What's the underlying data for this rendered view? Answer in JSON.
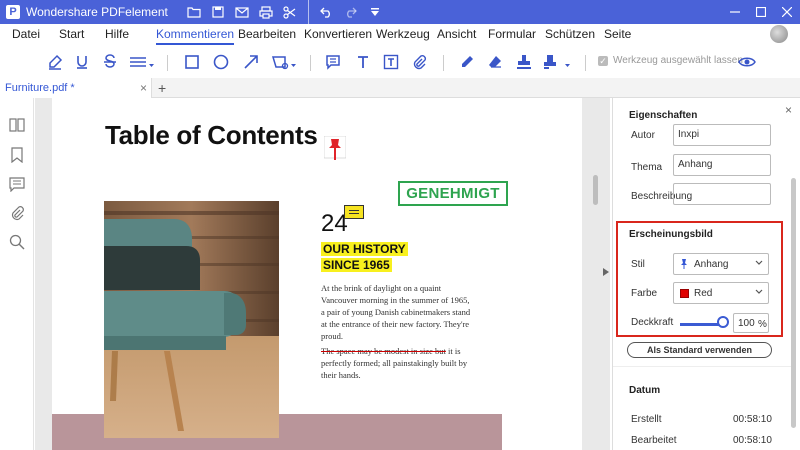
{
  "app": {
    "title": "Wondershare PDFelement",
    "accent": "#4a62d8"
  },
  "titlebar": {
    "quick_access_icons": [
      "folder-icon",
      "save-icon",
      "mail-icon",
      "print-icon",
      "scissors-icon",
      "undo-icon",
      "redo-icon",
      "quick-access-dropdown-icon"
    ],
    "window_buttons": [
      "minimize-icon",
      "maximize-icon",
      "close-icon"
    ]
  },
  "menu": {
    "items": [
      "Datei",
      "Start",
      "Hilfe",
      "Kommentieren",
      "Bearbeiten",
      "Konvertieren",
      "Werkzeug",
      "Ansicht",
      "Formular",
      "Schützen",
      "Seite"
    ],
    "active": "Kommentieren"
  },
  "toolbar": {
    "tools": [
      "highlight-icon",
      "underline-icon",
      "strikethrough-icon",
      "lines-icon",
      "rectangle-icon",
      "circle-icon",
      "arrow-icon",
      "shapes-icon",
      "comment-icon",
      "text-icon",
      "textbox-icon",
      "attachment-icon",
      "pencil-icon",
      "eraser-icon",
      "stamp-icon",
      "signature-icon"
    ],
    "keep_tool_label": "Werkzeug ausgewählt lassen",
    "eye_icon": "eye-icon"
  },
  "tabs": {
    "doc_tab": "Furniture.pdf *",
    "add": "+"
  },
  "leftbar": {
    "icons": [
      "thumbnails-icon",
      "bookmark-icon",
      "comments-icon",
      "attachments-icon",
      "search-icon"
    ]
  },
  "document": {
    "title": "Table of Contents",
    "stamp": "GENEHMIGT",
    "number": "24",
    "history_line1": "OUR HISTORY",
    "history_line2": "SINCE 1965",
    "paragraph1": "At the brink of daylight on a quaint Vancouver morning in the summer of 1965, a pair of young Danish cabinetmakers stand at the entrance of their new factory. They're proud.",
    "paragraph2_strike": "The space may be modest in size but",
    "paragraph2_rest": " it is perfectly formed; all painstakingly built by their hands."
  },
  "properties": {
    "heading": "Eigenschaften",
    "author_label": "Autor",
    "author_value": "Inxpi",
    "subject_label": "Thema",
    "subject_value": "Anhang",
    "description_label": "Beschreibung",
    "description_value": ""
  },
  "appearance": {
    "heading": "Erscheinungsbild",
    "style_label": "Stil",
    "style_value": "Anhang",
    "color_label": "Farbe",
    "color_value": "Red",
    "color_hex": "#e00000",
    "opacity_label": "Deckkraft",
    "opacity_value": "100",
    "opacity_unit": "%",
    "default_button": "Als Standard verwenden"
  },
  "date": {
    "heading": "Datum",
    "created_label": "Erstellt",
    "created_value": "00:58:10",
    "modified_label": "Bearbeitet",
    "modified_value": "00:58:10"
  }
}
